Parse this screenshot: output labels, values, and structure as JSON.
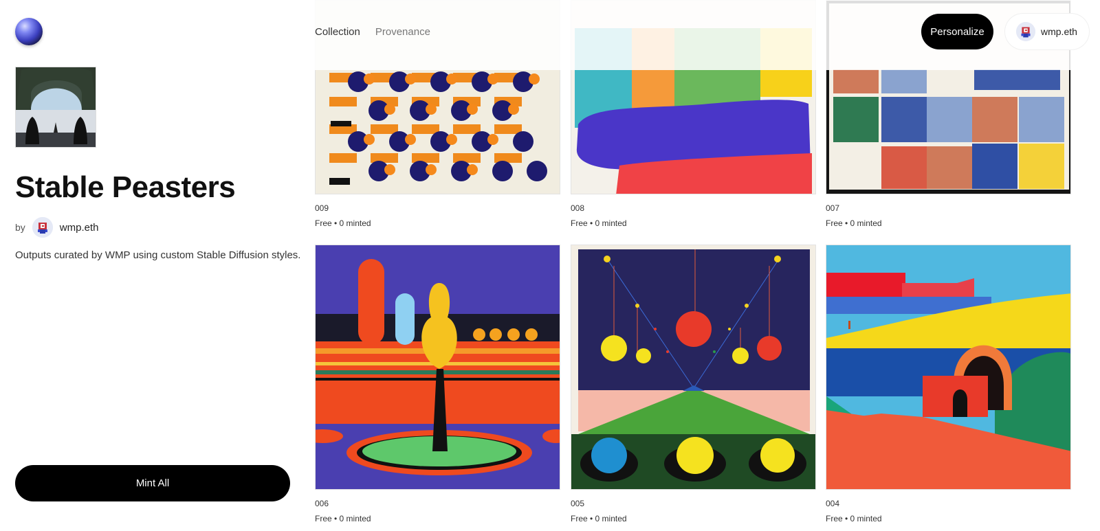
{
  "collection": {
    "title": "Stable Peasters",
    "by_label": "by",
    "creator": "wmp.eth",
    "description": "Outputs curated by WMP using custom Stable Diffusion styles.",
    "mint_all_label": "Mint All"
  },
  "nav": {
    "items": [
      {
        "label": "Collection"
      },
      {
        "label": "Provenance"
      }
    ]
  },
  "header": {
    "personalize_label": "Personalize",
    "account_name": "wmp.eth"
  },
  "cards": [
    {
      "number": "009",
      "meta": "Free • 0 minted"
    },
    {
      "number": "008",
      "meta": "Free • 0 minted"
    },
    {
      "number": "007",
      "meta": "Free • 0 minted"
    },
    {
      "number": "006",
      "meta": "Free • 0 minted"
    },
    {
      "number": "005",
      "meta": "Free • 0 minted"
    },
    {
      "number": "004",
      "meta": "Free • 0 minted"
    }
  ]
}
